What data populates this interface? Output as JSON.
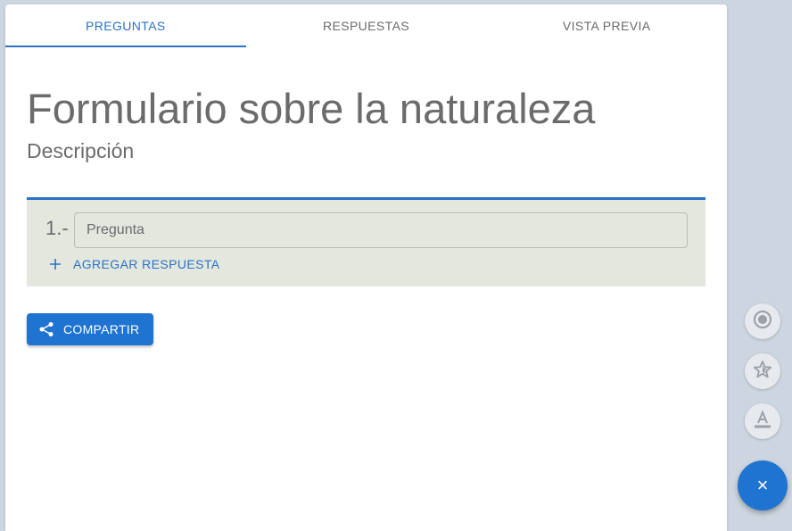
{
  "tabs": [
    {
      "label": "PREGUNTAS",
      "active": true
    },
    {
      "label": "RESPUESTAS",
      "active": false
    },
    {
      "label": "VISTA PREVIA",
      "active": false
    }
  ],
  "form": {
    "title": "Formulario sobre la naturaleza",
    "description": "Descripción"
  },
  "question": {
    "number": "1.-",
    "placeholder": "Pregunta",
    "value": "",
    "add_answer_label": "AGREGAR RESPUESTA"
  },
  "share_button": {
    "label": "COMPARTIR"
  },
  "fabs": [
    {
      "icon": "radio-button-icon"
    },
    {
      "icon": "star-rating-icon"
    },
    {
      "icon": "text-format-icon"
    }
  ],
  "main_fab": {
    "icon": "close-icon",
    "symbol": "×"
  },
  "colors": {
    "accent": "#2a72c6",
    "button": "#1f74d1",
    "question_bg": "#e3e7de",
    "page_bg": "#cdd6e0"
  }
}
